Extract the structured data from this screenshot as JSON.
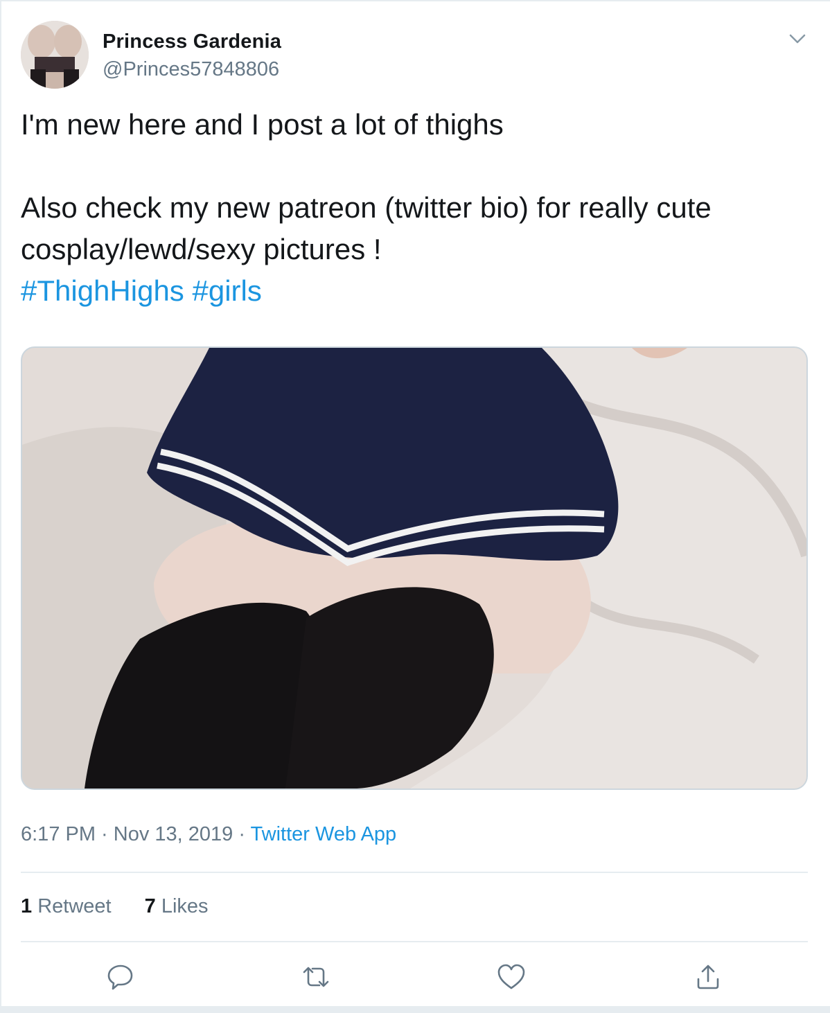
{
  "author": {
    "display_name": "Princess Gardenia",
    "handle": "@Princes57848806"
  },
  "tweet": {
    "line1": "I'm new here and I post a lot of thighs",
    "line2": "Also check my new patreon (twitter bio) for really cute",
    "line3": "cosplay/lewd/sexy pictures !",
    "hashtags": [
      "#ThighHighs",
      "#girls"
    ]
  },
  "meta": {
    "time": "6:17 PM",
    "separator": " · ",
    "date": "Nov 13, 2019",
    "source": "Twitter Web App"
  },
  "stats": {
    "retweets_count": "1",
    "retweets_label": "Retweet",
    "likes_count": "7",
    "likes_label": "Likes"
  },
  "icons": {
    "menu": "chevron-down-icon",
    "reply": "reply-icon",
    "retweet": "retweet-icon",
    "like": "heart-icon",
    "share": "share-icon"
  },
  "colors": {
    "link": "#1b95e0",
    "secondary_text": "#657786",
    "divider": "#e6ecf0"
  }
}
